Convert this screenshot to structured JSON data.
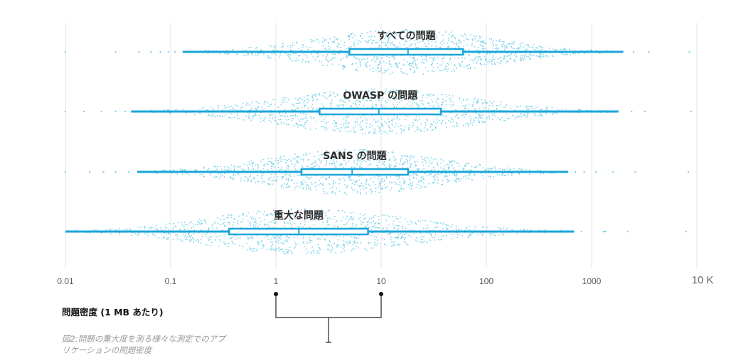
{
  "chart_data": {
    "type": "box",
    "x_scale": "log",
    "xlim": [
      0.01,
      10000
    ],
    "x_ticks": [
      {
        "value": 0.01,
        "label": "0.01"
      },
      {
        "value": 0.1,
        "label": "0.1"
      },
      {
        "value": 1,
        "label": "1"
      },
      {
        "value": 10,
        "label": "10"
      },
      {
        "value": 100,
        "label": "100"
      },
      {
        "value": 1000,
        "label": "1000"
      },
      {
        "value": 10000,
        "label": "10 K"
      }
    ],
    "xlabel": "問題密度 (1 MB あたり)",
    "caption": "図2:問題の重大度を測る様々な測定でのアプリケーションの問題密度",
    "grid": true,
    "colors": {
      "box": "#1aa6d9",
      "dots": "#7fd3ea",
      "grid": "#e3e3e3"
    },
    "series": [
      {
        "name": "すべての問題",
        "whisker_low": 0.13,
        "q1": 5,
        "median": 18,
        "q3": 60,
        "whisker_high": 2000,
        "outliers": [
          0.01,
          0.03,
          0.05,
          0.065,
          0.08,
          0.095,
          0.11,
          2500,
          3500,
          8500
        ]
      },
      {
        "name": "OWASP の問題",
        "whisker_low": 0.042,
        "q1": 2.6,
        "median": 9.5,
        "q3": 37,
        "whisker_high": 1800,
        "outliers": [
          0.01,
          0.015,
          0.022,
          0.03,
          0.037,
          2400,
          3200,
          8800
        ]
      },
      {
        "name": "SANS の問題",
        "whisker_low": 0.048,
        "q1": 1.75,
        "median": 5.3,
        "q3": 18,
        "whisker_high": 600,
        "outliers": [
          0.01,
          0.017,
          0.023,
          0.03,
          0.04,
          700,
          850,
          1100,
          1600,
          2600,
          8300
        ]
      },
      {
        "name": "重大な問題",
        "whisker_low": 0.01,
        "q1": 0.36,
        "median": 1.65,
        "q3": 7.5,
        "whisker_high": 680,
        "outliers": [
          800,
          1300,
          1350,
          2200,
          7900
        ]
      }
    ]
  }
}
